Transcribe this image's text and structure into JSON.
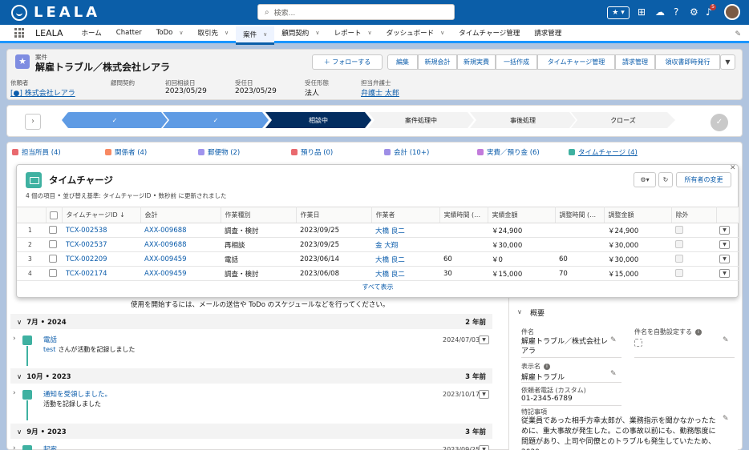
{
  "topbar": {
    "logo_text": "LEALA",
    "search_placeholder": "検索...",
    "notification_count": "5"
  },
  "nav": {
    "app_name": "LEALA",
    "items": [
      {
        "label": "ホーム",
        "dropdown": false
      },
      {
        "label": "Chatter",
        "dropdown": false
      },
      {
        "label": "ToDo",
        "dropdown": true
      },
      {
        "label": "取引先",
        "dropdown": true
      },
      {
        "label": "案件",
        "dropdown": true,
        "active": true
      },
      {
        "label": "顧問契約",
        "dropdown": true
      },
      {
        "label": "レポート",
        "dropdown": true
      },
      {
        "label": "ダッシュボード",
        "dropdown": true
      },
      {
        "label": "タイムチャージ管理",
        "dropdown": false
      },
      {
        "label": "請求管理",
        "dropdown": false
      }
    ]
  },
  "record": {
    "object_label": "案件",
    "title": "解雇トラブル／株式会社レアラ",
    "follow_label": "＋ フォローする",
    "actions": [
      "編集",
      "新規会計",
      "新規実費",
      "一括作成",
      "タイムチャージ管理",
      "請求管理",
      "領収書即時発行"
    ],
    "fields": [
      {
        "label": "依頼者",
        "value": "[●] 株式会社レアラ",
        "link": true
      },
      {
        "label": "顧問契約",
        "value": "",
        "link": false
      },
      {
        "label": "初回相談日",
        "value": "2023/05/29",
        "link": false
      },
      {
        "label": "受任日",
        "value": "2023/05/29",
        "link": false
      },
      {
        "label": "受任形態",
        "value": "法人",
        "link": false
      },
      {
        "label": "担当弁護士",
        "value": "弁護士 太郎",
        "link": true
      }
    ]
  },
  "path": {
    "stages": [
      {
        "label": "✓",
        "state": "complete"
      },
      {
        "label": "✓",
        "state": "complete"
      },
      {
        "label": "相談中",
        "state": "current"
      },
      {
        "label": "案件処理中",
        "state": "incomplete"
      },
      {
        "label": "事後処理",
        "state": "incomplete"
      },
      {
        "label": "クローズ",
        "state": "incomplete"
      }
    ]
  },
  "quick_links": [
    {
      "label": "担当所員 (4)",
      "color": "#e9696e"
    },
    {
      "label": "関係者 (4)",
      "color": "#f88962"
    },
    {
      "label": "郵便物 (2)",
      "color": "#a094ed"
    },
    {
      "label": "預り品 (0)",
      "color": "#e9696e"
    },
    {
      "label": "会計 (10+)",
      "color": "#9e8ee6"
    },
    {
      "label": "実費／預り金 (6)",
      "color": "#c27bdb"
    },
    {
      "label": "タイムチャージ (4)",
      "color": "#3fb1a1"
    }
  ],
  "timecharge": {
    "title": "タイムチャージ",
    "subtitle": "4 個の項目 • 並び替え基準: タイムチャージID • 数秒前 に更新されました",
    "owner_change_label": "所有者の変更",
    "columns": [
      "タイムチャージID ↓",
      "会計",
      "作業種別",
      "作業日",
      "作業者",
      "実績時間 (…",
      "実績金額",
      "調整時間 (…",
      "調整金額",
      "除外"
    ],
    "rows": [
      {
        "num": "1",
        "id": "TCX-002538",
        "account": "AXX-009688",
        "type": "調査・検討",
        "date": "2023/09/25",
        "worker": "大橋 良二",
        "hours": "",
        "amount": "￥24,900",
        "adj_hours": "",
        "adj_amount": "￥24,900"
      },
      {
        "num": "2",
        "id": "TCX-002537",
        "account": "AXX-009688",
        "type": "再相談",
        "date": "2023/09/25",
        "worker": "金 大翔",
        "hours": "",
        "amount": "￥30,000",
        "adj_hours": "",
        "adj_amount": "￥30,000"
      },
      {
        "num": "3",
        "id": "TCX-002209",
        "account": "AXX-009459",
        "type": "電話",
        "date": "2023/06/14",
        "worker": "大橋 良二",
        "hours": "60",
        "amount": "￥0",
        "adj_hours": "60",
        "adj_amount": "￥30,000"
      },
      {
        "num": "4",
        "id": "TCX-002174",
        "account": "AXX-009459",
        "type": "調査・検討",
        "date": "2023/06/08",
        "worker": "大橋 良二",
        "hours": "30",
        "amount": "￥15,000",
        "adj_hours": "70",
        "adj_amount": "￥15,000"
      }
    ],
    "view_all": "すべて表示"
  },
  "activity": {
    "intro": "使用を開始するには、メールの送信や ToDo のスケジュールなどを行ってください。",
    "sections": [
      {
        "month": "7月 • 2024",
        "ago": "2 年前",
        "item": {
          "title": "電話",
          "actor": "test",
          "text": "さんが活動を記録しました",
          "date": "2024/07/03"
        }
      },
      {
        "month": "10月 • 2023",
        "ago": "3 年前",
        "item": {
          "title": "通知を受領しました。",
          "actor": "",
          "text": "活動を記録しました",
          "date": "2023/10/17"
        }
      },
      {
        "month": "9月 • 2023",
        "ago": "3 年前",
        "item": {
          "title": "起案",
          "actor": "",
          "text": "",
          "date": "2023/09/25"
        }
      }
    ]
  },
  "detail": {
    "section_title": "概要",
    "case_name_label": "件名",
    "case_name_value": "解雇トラブル／株式会社レアラ",
    "auto_name_label": "件名を自動設定する",
    "display_name_label": "表示名",
    "display_name_value": "解雇トラブル",
    "phone_label": "依頼者電話 (カスタム)",
    "phone_value": "01-2345-6789",
    "notes_label": "特記事項",
    "notes_value": "従業員であった相手方幸太郎が、業務指示を聞かなかったために、重大事故が発生した。この事故以前にも、勤務態度に問題があり、上司や同僚とのトラブルも発生していたため、2020"
  }
}
